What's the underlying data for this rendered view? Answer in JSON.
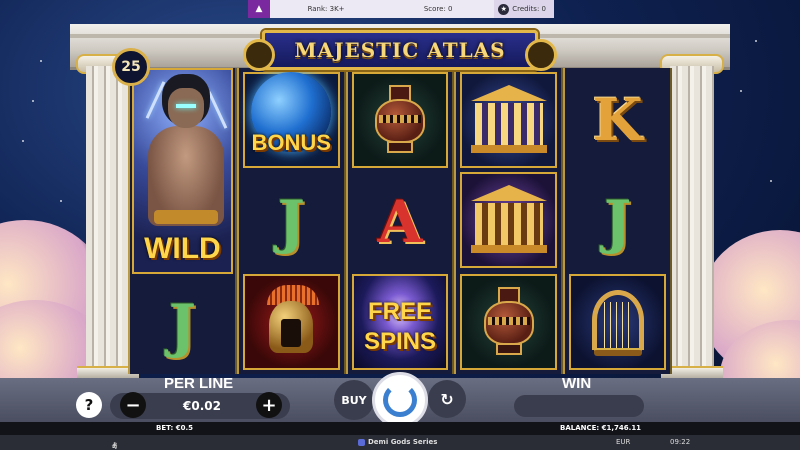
{
  "topbar": {
    "rank": "Rank: 3K+",
    "score": "Score: 0",
    "credits": "Credits: 0"
  },
  "title": "MAJESTIC ATLAS",
  "lines": "25",
  "symbols": {
    "wild": "WILD",
    "bonus": "BONUS",
    "free_spins_1": "FREE",
    "free_spins_2": "SPINS",
    "j": "J",
    "a": "A",
    "k": "K"
  },
  "controls": {
    "per_line_label": "PER LINE",
    "per_line_value": "€0.02",
    "help": "?",
    "minus": "−",
    "plus": "+",
    "buy": "BUY",
    "win_label": "WIN",
    "win_value": ""
  },
  "info": {
    "bet": "BET: €0.5",
    "balance": "BALANCE: €1,746.11"
  },
  "footer": {
    "series": "Demi Gods Series",
    "currency": "EUR",
    "time": "09:22"
  },
  "icons": [
    "trophy-icon",
    "star-icon",
    "home-icon",
    "sound-icon",
    "settings-icon",
    "spin-icon",
    "autoplay-icon"
  ]
}
